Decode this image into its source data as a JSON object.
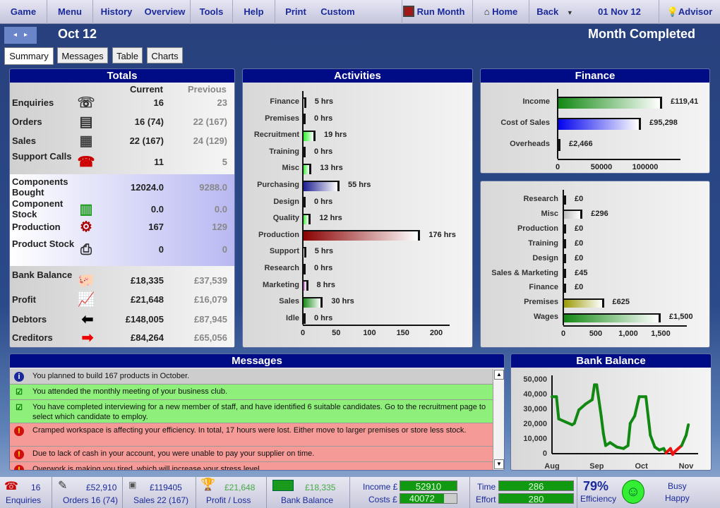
{
  "menu": {
    "game": "Game",
    "menu": "Menu",
    "history": "History",
    "overview": "Overview",
    "tools": "Tools",
    "help": "Help",
    "print": "Print",
    "custom": "Custom",
    "run_month": "Run Month",
    "home": "Home",
    "back": "Back",
    "date": "01 Nov 12",
    "advisor": "Advisor"
  },
  "header": {
    "prev": "◂",
    "next": "▸",
    "period": "Oct 12",
    "status": "Month Completed"
  },
  "tabs": [
    "Summary",
    "Messages",
    "Table",
    "Charts"
  ],
  "totals": {
    "title": "Totals",
    "col_current": "Current",
    "col_previous": "Previous",
    "rows": [
      {
        "label": "Enquiries",
        "current": "16",
        "previous": "23"
      },
      {
        "label": "Orders",
        "current": "16 (74)",
        "previous": "22 (167)"
      },
      {
        "label": "Sales",
        "current": "22 (167)",
        "previous": "24 (129)"
      },
      {
        "label": "Support Calls",
        "current": "11",
        "previous": "5"
      },
      {
        "label": "Components Bought",
        "current": "12024.0",
        "previous": "9288.0"
      },
      {
        "label": "Component Stock",
        "current": "0.0",
        "previous": "0.0"
      },
      {
        "label": "Production",
        "current": "167",
        "previous": "129"
      },
      {
        "label": "Product Stock",
        "current": "0",
        "previous": "0"
      },
      {
        "label": "Bank Balance",
        "current": "£18,335",
        "previous": "£37,539"
      },
      {
        "label": "Profit",
        "current": "£21,648",
        "previous": "£16,079"
      },
      {
        "label": "Debtors",
        "current": "£148,005",
        "previous": "£87,945"
      },
      {
        "label": "Creditors",
        "current": "£84,264",
        "previous": "£65,056"
      }
    ]
  },
  "messages": {
    "title": "Messages",
    "items": [
      {
        "type": "info",
        "text": "You planned to build 167 products in October."
      },
      {
        "type": "ok",
        "text": "You attended the monthly meeting of your business club."
      },
      {
        "type": "ok",
        "text": "You have completed interviewing for a new member of staff, and have identified 6 suitable candidates. Go to the recruitment page to select which candidate to employ."
      },
      {
        "type": "warn",
        "text": "Cramped workspace is affecting your efficiency. In total, 17 hours were lost. Either move to larger premises or store less stock."
      },
      {
        "type": "warn",
        "text": "Due to lack of cash in your account, you were unable to pay your supplier on time."
      },
      {
        "type": "warn",
        "text": "Overwork is making you tired, which will increase your stress level."
      }
    ]
  },
  "chart_data": [
    {
      "id": "activities",
      "type": "bar",
      "title": "Activities",
      "orientation": "horizontal",
      "categories": [
        "Finance",
        "Premises",
        "Recruitment",
        "Training",
        "Misc",
        "Purchasing",
        "Design",
        "Quality",
        "Production",
        "Support",
        "Research",
        "Marketing",
        "Sales",
        "Idle"
      ],
      "values": [
        5,
        0,
        19,
        0,
        13,
        55,
        0,
        12,
        176,
        5,
        0,
        8,
        30,
        0
      ],
      "value_labels": [
        "5 hrs",
        "0 hrs",
        "19 hrs",
        "0 hrs",
        "13 hrs",
        "55 hrs",
        "0 hrs",
        "12 hrs",
        "176 hrs",
        "5 hrs",
        "0 hrs",
        "8 hrs",
        "30 hrs",
        "0 hrs"
      ],
      "colors": [
        "#ffffff",
        "#22aa22",
        "#22ee22",
        "#111111",
        "#22ee22",
        "#1a1a90",
        "#22aa22",
        "#22ee22",
        "#8a0000",
        "#ffffff",
        "#22aa22",
        "#b040b0",
        "#118811",
        "#aa1111"
      ],
      "xlim": [
        0,
        220
      ],
      "xticks": [
        "0",
        "50",
        "100",
        "150",
        "200"
      ],
      "xtick_values": [
        0,
        50,
        100,
        150,
        200
      ]
    },
    {
      "id": "finance",
      "type": "bar",
      "title": "Finance",
      "orientation": "horizontal",
      "categories": [
        "Income",
        "Cost of Sales",
        "Overheads"
      ],
      "values": [
        119410,
        95298,
        2466
      ],
      "value_labels": [
        "£119,41",
        "£95,298",
        "£2,466"
      ],
      "colors": [
        "#118811",
        "#0000ee",
        "#cc1111"
      ],
      "xlim": [
        0,
        140000
      ],
      "xticks": [
        "0",
        "50000",
        "100000"
      ],
      "xtick_values": [
        0,
        50000,
        100000
      ]
    },
    {
      "id": "overheads",
      "type": "bar",
      "orientation": "horizontal",
      "categories": [
        "Research",
        "Misc",
        "Production",
        "Training",
        "Design",
        "Sales & Marketing",
        "Finance",
        "Premises",
        "Wages"
      ],
      "values": [
        0,
        296,
        0,
        0,
        0,
        45,
        0,
        625,
        1500
      ],
      "value_labels": [
        "£0",
        "£296",
        "£0",
        "£0",
        "£0",
        "£45",
        "£0",
        "£625",
        "£1,500"
      ],
      "colors": [
        "#cc1111",
        "#bbbbbb",
        "#111111",
        "#111111",
        "#22aa22",
        "#cc66cc",
        "#111111",
        "#999900",
        "#118811"
      ],
      "xlim": [
        0,
        1900
      ],
      "xticks": [
        "0",
        "500",
        "1,000",
        "1,500"
      ],
      "xtick_values": [
        0,
        500,
        1000,
        1500
      ]
    },
    {
      "id": "bank_balance",
      "type": "line",
      "title": "Bank Balance",
      "ylim": [
        0,
        50000
      ],
      "yticks": [
        "50,000",
        "40,000",
        "30,000",
        "20,000",
        "10,000",
        "0"
      ],
      "ytick_values": [
        50000,
        40000,
        30000,
        20000,
        10000,
        0
      ],
      "xticks": [
        "Aug",
        "Sep",
        "Oct",
        "Nov"
      ],
      "xtick_values": [
        0,
        1,
        2,
        3
      ],
      "x": [
        0,
        0.1,
        0.15,
        0.3,
        0.45,
        0.5,
        0.6,
        0.75,
        0.9,
        0.95,
        1.0,
        1.1,
        1.15,
        1.2,
        1.3,
        1.45,
        1.6,
        1.7,
        1.75,
        1.85,
        1.95,
        2.1,
        2.2,
        2.3,
        2.4,
        2.5,
        2.55,
        2.65,
        2.7,
        2.75,
        2.9,
        3.0,
        3.05
      ],
      "y": [
        38000,
        38000,
        23000,
        21000,
        19000,
        20000,
        29000,
        33000,
        36000,
        46000,
        46000,
        25000,
        13000,
        5000,
        7000,
        4000,
        3000,
        5000,
        20000,
        25000,
        38000,
        38000,
        12000,
        4000,
        2000,
        3000,
        0,
        3000,
        -1000,
        1000,
        5000,
        12000,
        19000
      ],
      "colors": {
        "positive": "#118811",
        "negative": "#ee1111"
      }
    }
  ],
  "statusbar": {
    "enquiries_value": "16",
    "enquiries_label": "Enquiries",
    "orders_value": "£52,910",
    "orders_label": "Orders  16 (74)",
    "sales_value": "£119405",
    "sales_label": "Sales  22 (167)",
    "profit_value": "£21,648",
    "profit_label": "Profit / Loss",
    "bank_value": "£18,335",
    "bank_label": "Bank Balance",
    "income_label": "Income £",
    "income_value": "52910",
    "costs_label": "Costs £",
    "costs_value": "40072",
    "costs_fill": 0.77,
    "time_label": "Time",
    "time_value": "286",
    "effort_label": "Effort",
    "effort_value": "280",
    "efficiency_value": "79%",
    "efficiency_label": "Efficiency",
    "mood1": "Busy",
    "mood2": "Happy"
  }
}
